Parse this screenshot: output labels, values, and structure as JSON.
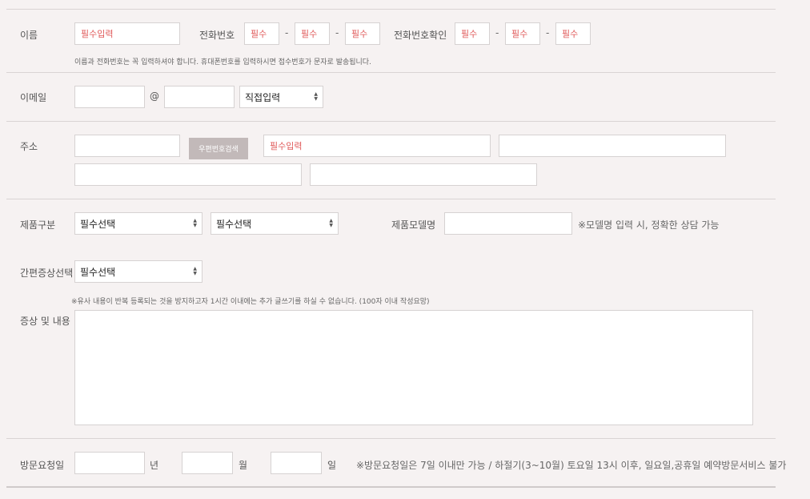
{
  "name": {
    "label": "이름",
    "placeholder": "필수입력"
  },
  "phone": {
    "label": "전화번호",
    "placeholder1": "필수",
    "placeholder2": "필수",
    "placeholder3": "필수",
    "confirm_label": "전화번호확인",
    "confirm_placeholder1": "필수",
    "confirm_placeholder2": "필수",
    "confirm_placeholder3": "필수",
    "dash": "-"
  },
  "name_note": "이름과 전화번호는 꼭 입력하셔야 합니다. 휴대폰번호를 입력하시면 접수번호가 문자로 발송됩니다.",
  "email": {
    "label": "이메일",
    "at": "@",
    "domain_select": "직접입력"
  },
  "address": {
    "label": "주소",
    "zip_button": "우편번호검색",
    "addr_placeholder": "필수입력"
  },
  "product": {
    "label": "제품구분",
    "select1": "필수선택",
    "select2": "필수선택",
    "model_label": "제품모델명",
    "model_note": "※모델명 입력 시, 정확한 상담 가능"
  },
  "symptom": {
    "label": "간편증상선택",
    "select": "필수선택",
    "note": "※유사 내용이 반복 등록되는 것을 방지하고자 1시간 이내에는 추가 글쓰기를 하실 수 없습니다. (100자 이내 작성요망)",
    "detail_label": "증상 및 내용"
  },
  "visit": {
    "label": "방문요청일",
    "year": "년",
    "month": "월",
    "day": "일",
    "note": "※방문요청일은 7일 이내만 가능 / 하절기(3~10월) 토요일 13시 이후, 일요일,공휴일 예약방문서비스 불가"
  },
  "colors": {
    "required_text": "#e05a5a",
    "button_bg": "#c2b9b9",
    "background": "#f6f2f2"
  }
}
